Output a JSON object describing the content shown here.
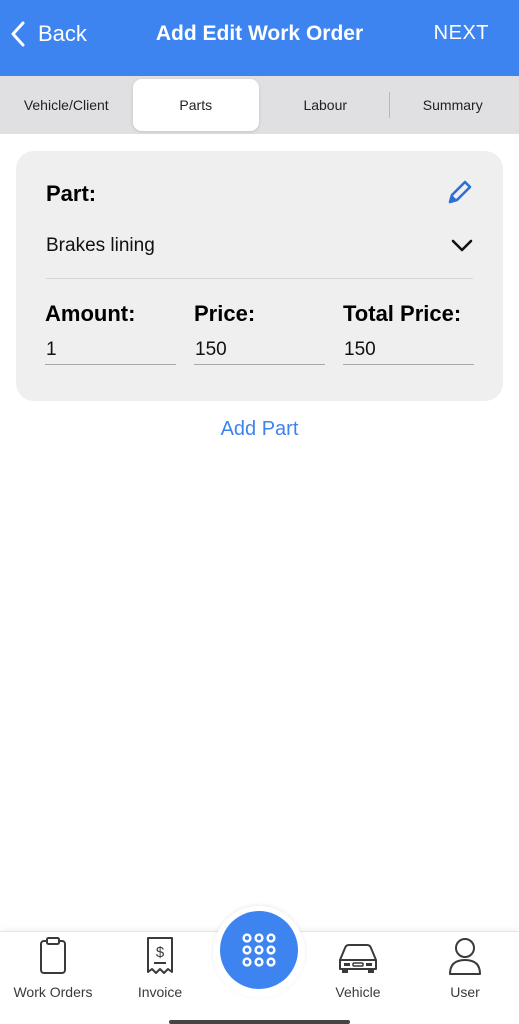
{
  "header": {
    "back_label": "Back",
    "title": "Add Edit Work Order",
    "next_label": "NEXT",
    "accent_color": "#3d84f0"
  },
  "tabs": [
    {
      "label": "Vehicle/Client",
      "active": false
    },
    {
      "label": "Parts",
      "active": true
    },
    {
      "label": "Labour",
      "active": false
    },
    {
      "label": "Summary",
      "active": false
    }
  ],
  "part_card": {
    "part_label": "Part:",
    "selected_part": "Brakes lining",
    "amount_label": "Amount:",
    "amount_value": "1",
    "price_label": "Price:",
    "price_value": "150",
    "total_label": "Total Price:",
    "total_value": "150",
    "edit_icon": "pencil-icon",
    "dropdown_icon": "chevron-down-icon"
  },
  "add_part_label": "Add Part",
  "bottom_nav": {
    "items": [
      {
        "label": "Work Orders",
        "icon": "clipboard-icon"
      },
      {
        "label": "Invoice",
        "icon": "receipt-dollar-icon"
      },
      {
        "label": "Vehicle",
        "icon": "car-icon"
      },
      {
        "label": "User",
        "icon": "user-icon"
      }
    ],
    "center_button_icon": "grid-dots-icon"
  }
}
